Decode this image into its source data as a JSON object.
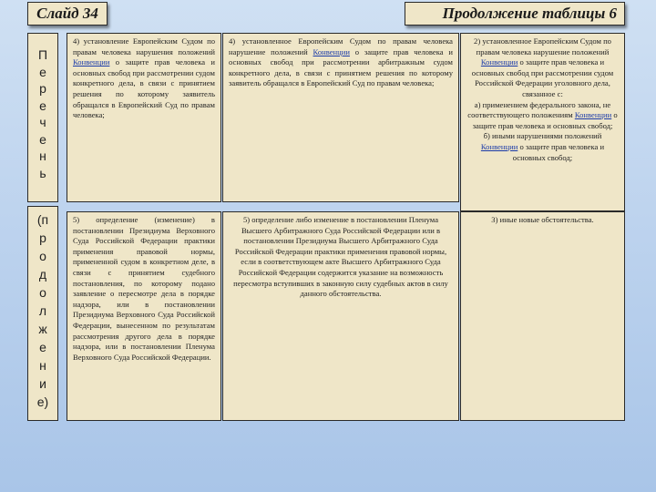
{
  "header": {
    "slide_label": "Слайд 34",
    "heading": "Продолжение таблицы 6"
  },
  "side": {
    "top_letters": [
      "П",
      "е",
      "р",
      "е",
      "ч",
      "е",
      "н",
      "ь"
    ],
    "bottom_letters": [
      "(п",
      "р",
      "о",
      "д",
      "о",
      "л",
      "ж",
      "е",
      "н",
      "и",
      "е)"
    ]
  },
  "table": {
    "row1": {
      "c1": {
        "before": "4) установление Европейским Судом по правам человека нарушения положений ",
        "link": "Конвенции",
        "after": " о защите прав человека и основных свобод при рассмотрении судом конкретного дела, в связи с принятием решения по которому заявитель обращался в Европейский Суд по правам человека;"
      },
      "c2": {
        "before": "4) установленное Европейским Судом по правам человека нарушение положений ",
        "link": "Конвенции",
        "after": " о защите прав человека и основных свобод при рассмотрении арбитражным судом конкретного дела, в связи с принятием решения по которому заявитель обращался в Европейский Суд по правам человека;"
      },
      "c3": {
        "line1_before": "2) установленное Европейским Судом по правам человека нарушение положений ",
        "line1_link": "Конвенции",
        "line1_after": " о защите прав человека и основных свобод при рассмотрении судом Российской Федерации уголовного дела, связанное с:",
        "line2": "а) применением федерального закона, не соответствующего положениям ",
        "line2_link": "Конвенции",
        "line2_after": " о защите прав человека и основных свобод;",
        "line3_before": "б) иными нарушениями положений ",
        "line3_link": "Конвенции",
        "line3_after": " о защите прав человека и основных свобод;"
      }
    },
    "row2": {
      "c4": "5) определение (изменение) в постановлении Президиума Верховного Суда Российской Федерации практики применения правовой нормы, примененной судом в конкретном деле, в связи с принятием судебного постановления, по которому подано заявление о пересмотре дела в порядке надзора, или в постановлении Президиума Верховного Суда Российской Федерации, вынесенном по результатам рассмотрения другого дела в порядке надзора, или в постановлении Пленума Верховного Суда Российской Федерации.",
      "c5": "5) определение либо изменение в постановлении Пленума Высшего Арбитражного Суда Российской Федерации или в постановлении Президиума Высшего Арбитражного Суда Российской Федерации практики применения правовой нормы, если в соответствующем акте Высшего Арбитражного Суда Российской Федерации содержится указание на возможность пересмотра вступивших в законную силу судебных актов в силу данного обстоятельства.",
      "c6": "3) иные новые обстоятельства."
    }
  }
}
